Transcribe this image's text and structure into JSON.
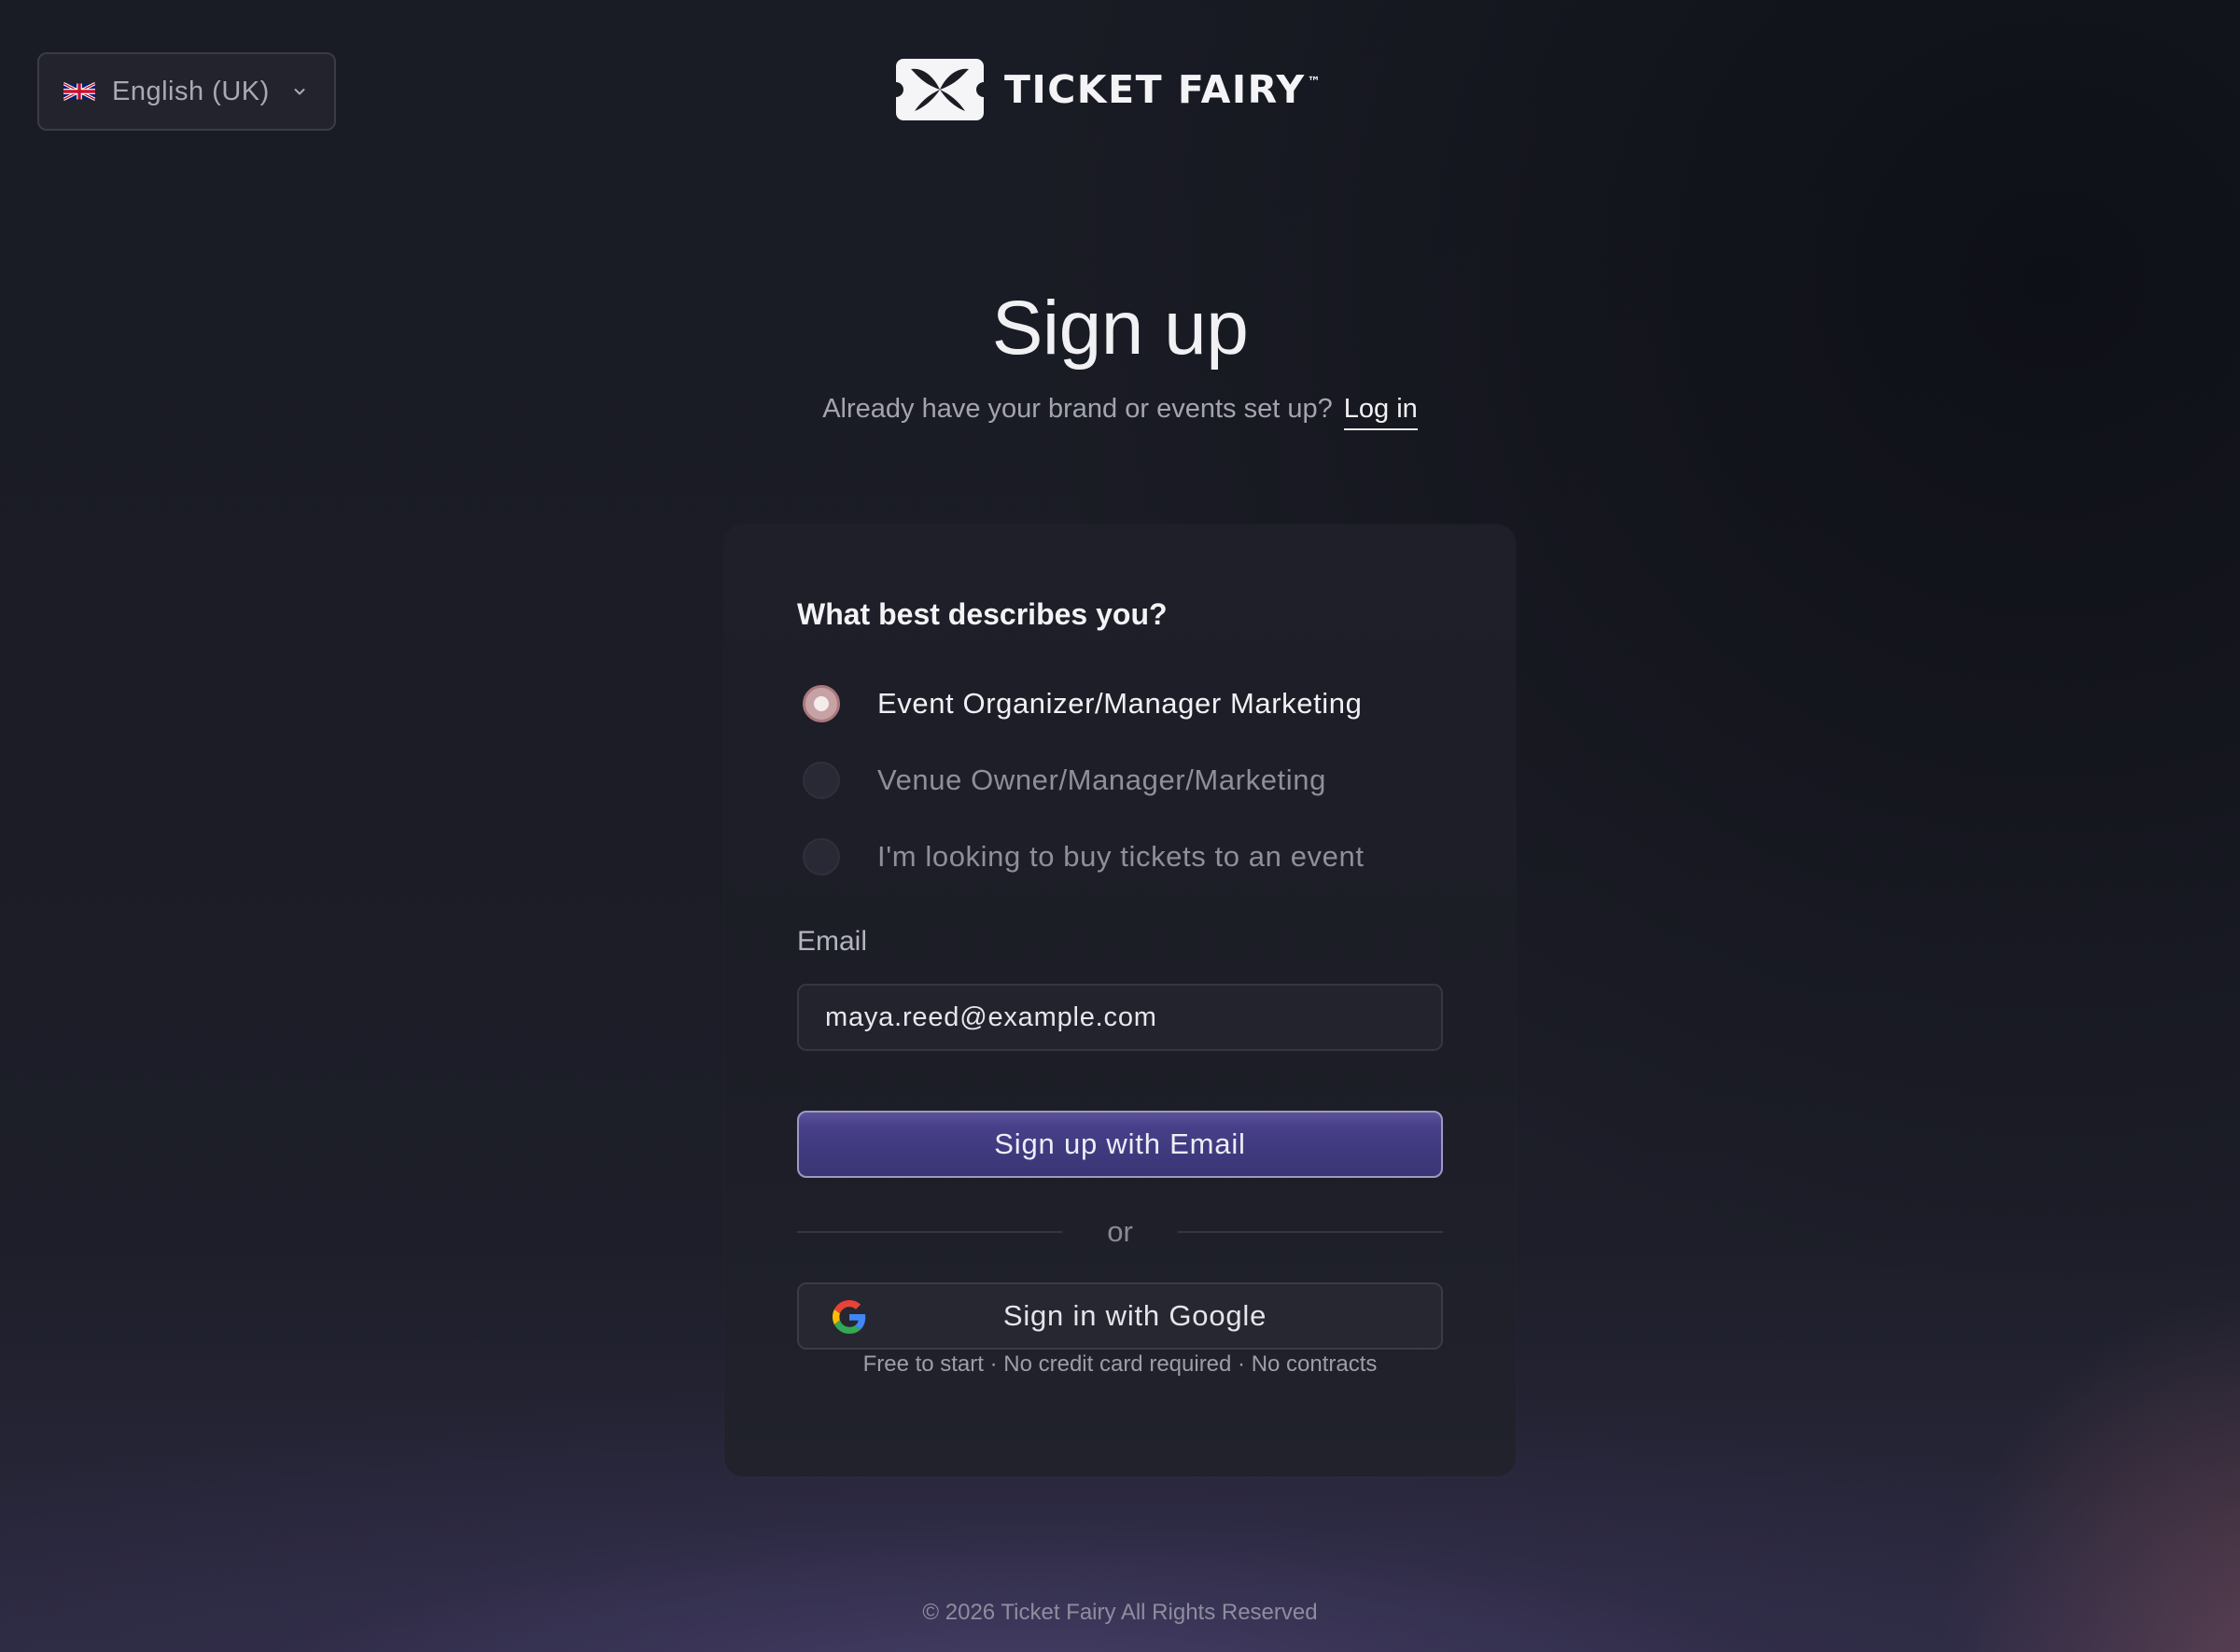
{
  "language_selector": {
    "label": "English (UK)",
    "flag_icon": "uk-flag-icon",
    "chevron_icon": "chevron-down-icon"
  },
  "brand": {
    "name": "TICKET FAIRY",
    "trademark": "™",
    "logo_icon": "ticket-fairy-logo-icon"
  },
  "header": {
    "title": "Sign up",
    "subtitle": "Already have your brand or events set up?",
    "login_link": "Log in"
  },
  "form": {
    "question": "What best describes you?",
    "options": [
      {
        "label": "Event Organizer/Manager Marketing",
        "selected": true
      },
      {
        "label": "Venue Owner/Manager/Marketing",
        "selected": false
      },
      {
        "label": "I'm looking to buy tickets to an event",
        "selected": false
      }
    ],
    "email_label": "Email",
    "email_value": "maya.reed@example.com",
    "submit_label": "Sign up with Email",
    "divider_text": "or",
    "google_label": "Sign in with Google",
    "google_icon": "google-icon",
    "fineprint": "Free to start · No credit card required · No contracts"
  },
  "footer": {
    "copyright": "© 2026 Ticket Fairy All Rights Reserved"
  },
  "colors": {
    "background": "#1a1c25",
    "card": "#1e1f28",
    "primary_button": "#3f3a7e",
    "radio_selected": "#c7a2a5",
    "text": "#f1f1f4",
    "muted_text": "#8f8f9c"
  }
}
